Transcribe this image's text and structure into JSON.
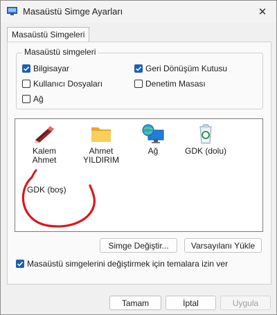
{
  "window": {
    "title": "Masaüstü Simge Ayarları",
    "close_glyph": "✕"
  },
  "tab": {
    "label": "Masaüstü Simgeleri"
  },
  "group": {
    "legend": "Masaüstü simgeleri",
    "checkboxes": [
      {
        "label": "Bilgisayar",
        "checked": true
      },
      {
        "label": "Geri Dönüşüm Kutusu",
        "checked": true
      },
      {
        "label": "Kullanıcı Dosyaları",
        "checked": false
      },
      {
        "label": "Denetim Masası",
        "checked": false
      },
      {
        "label": "Ağ",
        "checked": false
      }
    ]
  },
  "icons": [
    {
      "label": "Kalem Ahmet",
      "icon": "computer-pencil-icon"
    },
    {
      "label": "Ahmet YILDIRIM",
      "icon": "user-folder-icon"
    },
    {
      "label": "Ağ",
      "icon": "network-icon"
    },
    {
      "label": "GDK (dolu)",
      "icon": "recycle-bin-full-icon"
    },
    {
      "label": "GDK (boş)",
      "icon": "recycle-bin-empty-icon"
    }
  ],
  "buttons": {
    "change_icon": "Simge Değiştir...",
    "restore_default": "Varsayılanı Yükle",
    "ok": "Tamam",
    "cancel": "İptal",
    "apply": "Uygula"
  },
  "theme_checkbox": {
    "label": "Masaüstü simgelerini değiştirmek için temalara izin ver",
    "checked": true
  },
  "colors": {
    "accent": "#1a5fb4",
    "annotation": "#e0141c"
  }
}
